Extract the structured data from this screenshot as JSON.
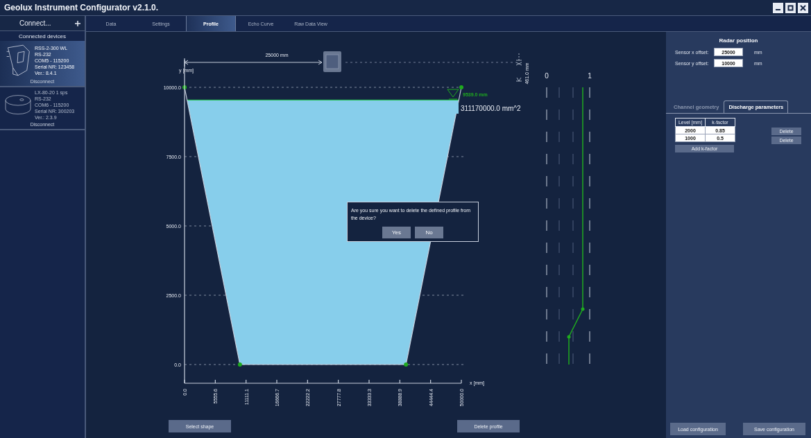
{
  "window": {
    "title": "Geolux Instrument Configurator v2.1.0."
  },
  "sidebar": {
    "connect_button": "Connect...",
    "section_title": "Connected devices",
    "devices": [
      {
        "kind": "radar",
        "selected": true,
        "lines": [
          "RSS-2-300 WL",
          "RS-232",
          "COM5 - 115200",
          "Serial NR: 123458",
          "Ver.: 8.4.1"
        ],
        "disconnect": "Disconnect"
      },
      {
        "kind": "puck",
        "selected": false,
        "lines": [
          "LX-80-20 1 sps",
          "RS-232",
          "COM6 - 115200",
          "Serial NR: 300203",
          "Ver.: 2.3.9"
        ],
        "disconnect": "Disconnect"
      }
    ]
  },
  "tabs": [
    {
      "label": "Data",
      "selected": false
    },
    {
      "label": "Settings",
      "selected": false
    },
    {
      "label": "Profile",
      "selected": true
    },
    {
      "label": "Echo Curve",
      "selected": false
    },
    {
      "label": "Raw Data View",
      "selected": false
    }
  ],
  "profile_view": {
    "chart_data": {
      "type": "line",
      "xlabel": "x [mm]",
      "ylabel": "y [mm]",
      "x": [
        0,
        10000,
        40000,
        50000
      ],
      "series": [
        {
          "color": "#c8d0de",
          "values": [
            10000,
            0,
            0,
            10000
          ],
          "marker": "o"
        }
      ],
      "xlim": [
        0,
        50000
      ],
      "ylim": [
        0,
        11000
      ],
      "grid": true,
      "ref_lines": [
        {
          "axis": "y",
          "value": 9539,
          "color": "#2bbf5a"
        },
        {
          "axis": "y",
          "value": 10900,
          "color": "#8a96ae"
        }
      ],
      "xticks": [
        {
          "value": 0,
          "label": "0.0"
        },
        {
          "value": 5555.6,
          "label": "5555.6"
        },
        {
          "value": 11111.1,
          "label": "11111.1"
        },
        {
          "value": 16666.7,
          "label": "16666.7"
        },
        {
          "value": 22222.2,
          "label": "22222.2"
        },
        {
          "value": 27777.8,
          "label": "27777.8"
        },
        {
          "value": 33333.3,
          "label": "33333.3"
        },
        {
          "value": 38888.9,
          "label": "38888.9"
        },
        {
          "value": 44444.4,
          "label": "44444.4"
        },
        {
          "value": 50000,
          "label": "50000.0"
        }
      ],
      "yticks": [
        {
          "value": 0,
          "label": "0.0"
        },
        {
          "value": 2500,
          "label": "2500.0"
        },
        {
          "value": 5000,
          "label": "5000.0"
        },
        {
          "value": 7500,
          "label": "7500.0"
        },
        {
          "value": 10000,
          "label": "10000.0"
        }
      ]
    },
    "water_level": "9539.0 mm",
    "sensor_distance": "25000 mm",
    "area": "311170000.0 mm^2",
    "sensor_gap": "461.0 mm",
    "meter": {
      "labels": [
        "0",
        "1"
      ]
    },
    "buttons": [
      "Select shape",
      "Delete profile"
    ]
  },
  "dialog": {
    "message": "Are you sure you want to delete the defined profile from the device?",
    "buttons": [
      "Yes",
      "No"
    ]
  },
  "right_panel": {
    "title": "Radar position",
    "fields": [
      {
        "label": "Sensor x offset:",
        "value": "25000",
        "unit": "mm"
      },
      {
        "label": "Sensor y offset:",
        "value": "10000",
        "unit": "mm"
      }
    ],
    "tabs": [
      {
        "label": "Channel geometry",
        "selected": false
      },
      {
        "label": "Discharge parameters",
        "selected": true
      }
    ],
    "table": {
      "columns": [
        "Level [mm]",
        "k-factor"
      ],
      "rows": [
        {
          "cells": [
            "2000",
            "0.85"
          ],
          "delete": "Delete"
        },
        {
          "cells": [
            "1000",
            "0.5"
          ],
          "delete": "Delete"
        }
      ]
    },
    "add_button": "Add k-factor",
    "footer_buttons": [
      "Load configuration",
      "Save configuration"
    ]
  }
}
